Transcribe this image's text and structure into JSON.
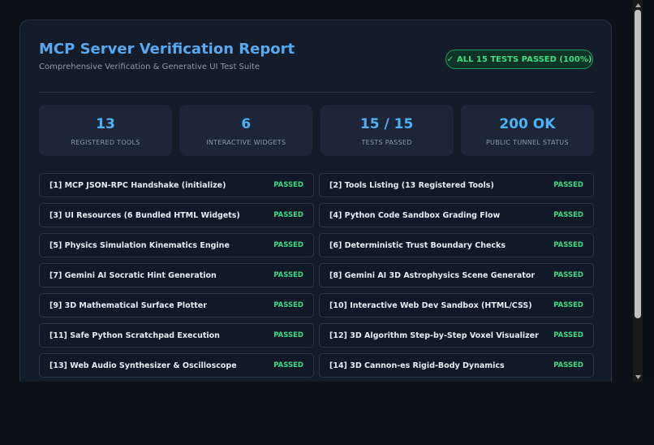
{
  "header": {
    "title": "MCP Server Verification Report",
    "subtitle": "Comprehensive Verification & Generative UI Test Suite",
    "status_icon": "check-icon",
    "status_text": "ALL 15 TESTS PASSED (100%)"
  },
  "stats": [
    {
      "value": "13",
      "label": "REGISTERED TOOLS"
    },
    {
      "value": "6",
      "label": "INTERACTIVE WIDGETS"
    },
    {
      "value": "15 / 15",
      "label": "TESTS PASSED"
    },
    {
      "value": "200 OK",
      "label": "PUBLIC TUNNEL STATUS"
    }
  ],
  "tests": [
    {
      "name": "[1] MCP JSON-RPC Handshake (initialize)",
      "status": "PASSED"
    },
    {
      "name": "[2] Tools Listing (13 Registered Tools)",
      "status": "PASSED"
    },
    {
      "name": "[3] UI Resources (6 Bundled HTML Widgets)",
      "status": "PASSED"
    },
    {
      "name": "[4] Python Code Sandbox Grading Flow",
      "status": "PASSED"
    },
    {
      "name": "[5] Physics Simulation Kinematics Engine",
      "status": "PASSED"
    },
    {
      "name": "[6] Deterministic Trust Boundary Checks",
      "status": "PASSED"
    },
    {
      "name": "[7] Gemini AI Socratic Hint Generation",
      "status": "PASSED"
    },
    {
      "name": "[8] Gemini AI 3D Astrophysics Scene Generator",
      "status": "PASSED"
    },
    {
      "name": "[9] 3D Mathematical Surface Plotter",
      "status": "PASSED"
    },
    {
      "name": "[10] Interactive Web Dev Sandbox (HTML/CSS)",
      "status": "PASSED"
    },
    {
      "name": "[11] Safe Python Scratchpad Execution",
      "status": "PASSED"
    },
    {
      "name": "[12] 3D Algorithm Step-by-Step Voxel Visualizer",
      "status": "PASSED"
    },
    {
      "name": "[13] Web Audio Synthesizer & Oscilloscope",
      "status": "PASSED"
    },
    {
      "name": "[14] 3D Cannon-es Rigid-Body Dynamics",
      "status": "PASSED"
    }
  ],
  "colors": {
    "accent": "#58a8f0",
    "success": "#3ddc84",
    "background": "#0d1117",
    "card": "#141c2a"
  }
}
